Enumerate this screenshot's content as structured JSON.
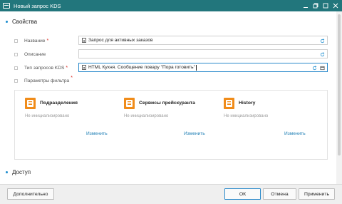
{
  "window": {
    "title": "Новый запрос KDS"
  },
  "sections": {
    "properties": "Свойства",
    "access": "Доступ"
  },
  "fields": [
    {
      "label": "Название",
      "required": "*",
      "value": "Запрос для активных заказов"
    },
    {
      "label": "Описание",
      "required": "",
      "value": ""
    },
    {
      "label": "Тип запросов KDS",
      "required": "*",
      "value": "HTML Кухня. Сообщение повару \"Пора готовить\""
    },
    {
      "label": "Параметры фильтра",
      "required": "*",
      "value": ""
    }
  ],
  "filter_cards": [
    {
      "title": "Подразделения",
      "status": "Не инициализировано",
      "link": "Изменить"
    },
    {
      "title": "Сервисы прейскуранта",
      "status": "Не инициализировано",
      "link": "Изменить"
    },
    {
      "title": "History",
      "status": "Не инициализировано",
      "link": "Изменить"
    }
  ],
  "footer": {
    "more": "Дополнительно",
    "ok": "ОК",
    "cancel": "Отмена",
    "apply": "Применить"
  },
  "colors": {
    "titlebar": "#22767c",
    "accent": "#1b8ccf",
    "card_icon": "#f08c1a",
    "required": "#d9261c",
    "link": "#1f7fb5"
  }
}
